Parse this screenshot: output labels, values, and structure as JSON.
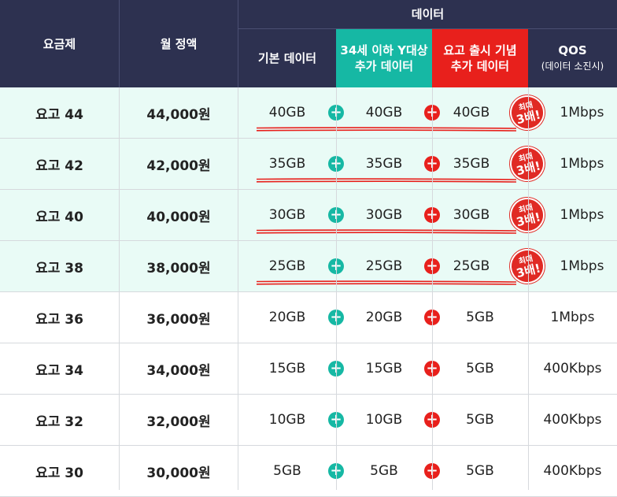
{
  "header": {
    "plan": "요금제",
    "monthly": "월 정액",
    "data": "데이터",
    "base_data": "기본 데이터",
    "y_extra": "34세 이하 Y대상\n추가 데이터",
    "launch_extra": "요고 출시 기념\n추가 데이터",
    "qos": "QOS",
    "qos_sub": "(데이터 소진시)"
  },
  "badge": {
    "line1": "최대",
    "line2": "3배!"
  },
  "rows": [
    {
      "plan": "요고 44",
      "price": "44,000원",
      "base": "40GB",
      "y": "40GB",
      "launch": "40GB",
      "qos": "1Mbps",
      "highlight": true
    },
    {
      "plan": "요고 42",
      "price": "42,000원",
      "base": "35GB",
      "y": "35GB",
      "launch": "35GB",
      "qos": "1Mbps",
      "highlight": true
    },
    {
      "plan": "요고 40",
      "price": "40,000원",
      "base": "30GB",
      "y": "30GB",
      "launch": "30GB",
      "qos": "1Mbps",
      "highlight": true
    },
    {
      "plan": "요고 38",
      "price": "38,000원",
      "base": "25GB",
      "y": "25GB",
      "launch": "25GB",
      "qos": "1Mbps",
      "highlight": true
    },
    {
      "plan": "요고 36",
      "price": "36,000원",
      "base": "20GB",
      "y": "20GB",
      "launch": "5GB",
      "qos": "1Mbps",
      "highlight": false
    },
    {
      "plan": "요고 34",
      "price": "34,000원",
      "base": "15GB",
      "y": "15GB",
      "launch": "5GB",
      "qos": "400Kbps",
      "highlight": false
    },
    {
      "plan": "요고 32",
      "price": "32,000원",
      "base": "10GB",
      "y": "10GB",
      "launch": "5GB",
      "qos": "400Kbps",
      "highlight": false
    },
    {
      "plan": "요고 30",
      "price": "30,000원",
      "base": "5GB",
      "y": "5GB",
      "launch": "5GB",
      "qos": "400Kbps",
      "highlight": false
    }
  ],
  "colors": {
    "header_bg": "#2d3150",
    "teal": "#16b8a4",
    "red": "#e8201c",
    "highlight_row": "#e9fbf6"
  },
  "icons": {
    "plus_green": "plus-icon",
    "plus_red": "plus-icon",
    "badge": "max-3x-stamp"
  }
}
